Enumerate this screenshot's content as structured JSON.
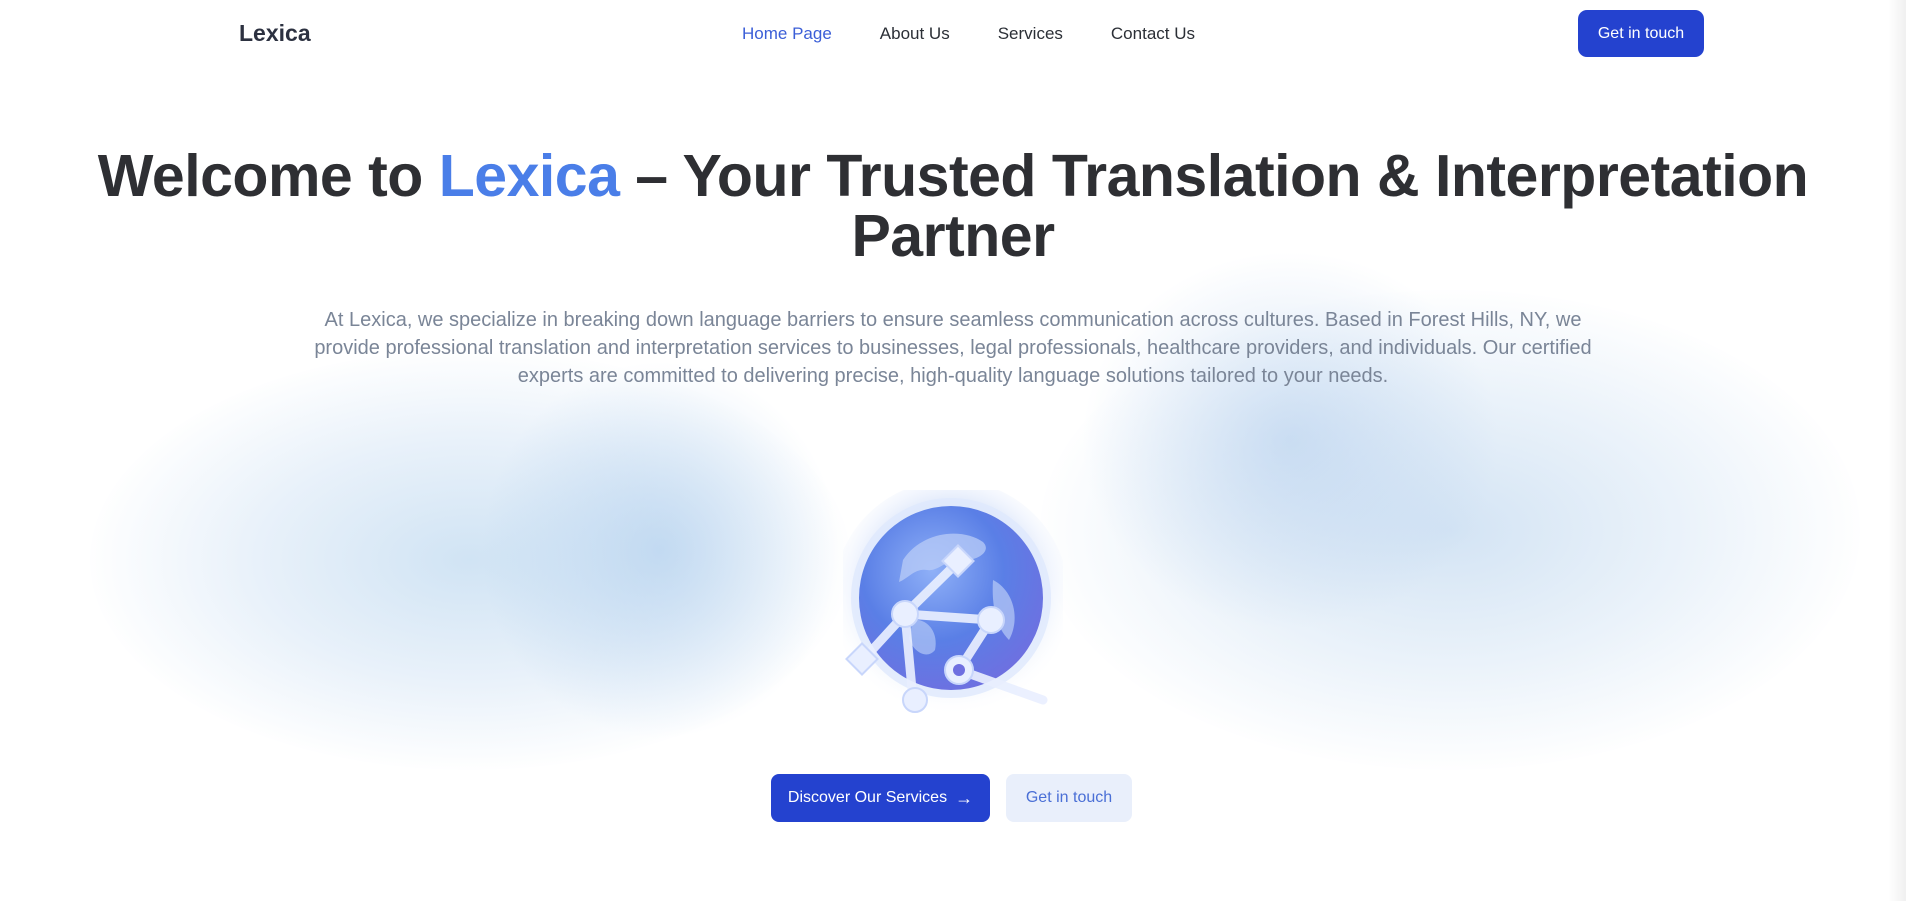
{
  "nav": {
    "logo": "Lexica",
    "links": [
      {
        "label": "Home Page",
        "active": true
      },
      {
        "label": "About Us",
        "active": false
      },
      {
        "label": "Services",
        "active": false
      },
      {
        "label": "Contact Us",
        "active": false
      }
    ],
    "cta_label": "Get in touch"
  },
  "hero": {
    "title_prefix": "Welcome to ",
    "title_accent": "Lexica",
    "title_suffix": " – Your Trusted Translation & Interpretation Partner",
    "description": "At Lexica, we specialize in breaking down language barriers to ensure seamless communication across cultures. Based in Forest Hills, NY, we provide professional translation and interpretation services to businesses, legal professionals, healthcare providers, and individuals. Our certified experts are committed to delivering precise, high-quality language solutions tailored to your needs.",
    "illustration_icon": "globe-network-icon"
  },
  "actions": {
    "primary_label": "Discover Our Services",
    "primary_arrow": "→",
    "secondary_label": "Get in touch"
  },
  "colors": {
    "brand": "#2442cf",
    "accent": "#4a7ee8",
    "active_link": "#3b5ed7",
    "heading": "#2e2f33",
    "body_text": "#7a8597"
  }
}
